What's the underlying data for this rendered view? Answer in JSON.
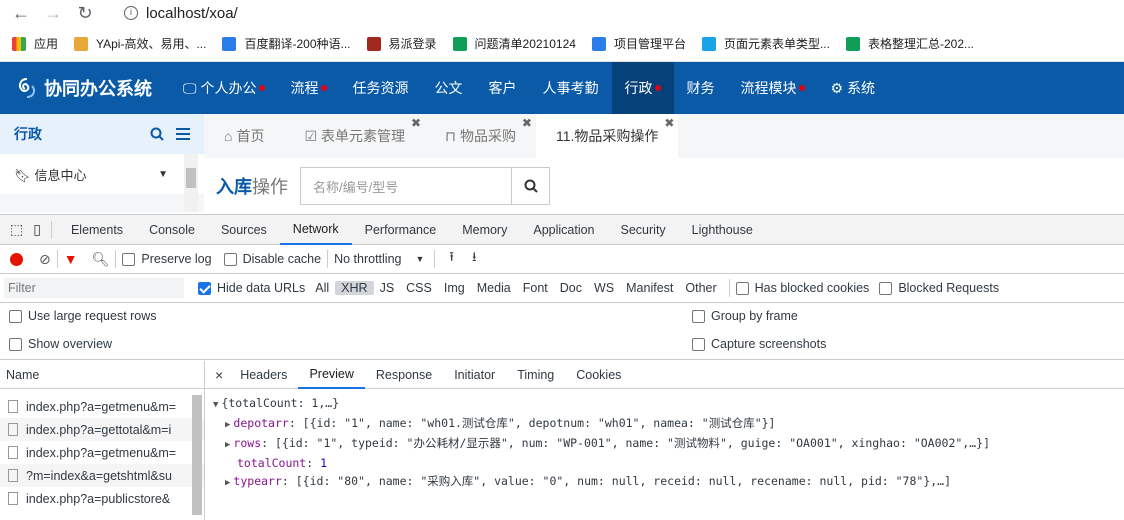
{
  "browser": {
    "url": "localhost/xoa/"
  },
  "bookmarks": [
    {
      "label": "应用",
      "icon": "apps-grid-icon",
      "color": "#4285f4"
    },
    {
      "label": "YApi-高效、易用、...",
      "icon": "yapi-logo-icon",
      "color": "#e8a838"
    },
    {
      "label": "百度翻译-200种语...",
      "icon": "baidu-translate-icon",
      "color": "#2b7de9"
    },
    {
      "label": "易派登录",
      "icon": "ball-icon",
      "color": "#a0281e"
    },
    {
      "label": "问题清单20210124",
      "icon": "sheets-icon",
      "color": "#0f9d58"
    },
    {
      "label": "项目管理平台",
      "icon": "swirl-icon",
      "color": "#2b7de9"
    },
    {
      "label": "页面元素表单类型...",
      "icon": "chat-icon",
      "color": "#1aa3e8"
    },
    {
      "label": "表格整理汇总-202...",
      "icon": "sheets-icon",
      "color": "#0f9d58"
    }
  ],
  "app": {
    "title": "协同办公系统"
  },
  "nav": [
    {
      "label": "个人办公",
      "icon": "monitor-icon",
      "dot": true
    },
    {
      "label": "流程",
      "icon": "",
      "dot": true
    },
    {
      "label": "任务资源",
      "icon": "",
      "dot": false
    },
    {
      "label": "公文",
      "icon": "",
      "dot": false
    },
    {
      "label": "客户",
      "icon": "",
      "dot": false
    },
    {
      "label": "人事考勤",
      "icon": "",
      "dot": false
    },
    {
      "label": "行政",
      "icon": "",
      "dot": true,
      "active": true
    },
    {
      "label": "财务",
      "icon": "",
      "dot": false
    },
    {
      "label": "流程模块",
      "icon": "",
      "dot": true
    },
    {
      "label": "系统",
      "icon": "gear-icon",
      "dot": false
    }
  ],
  "sidebar": {
    "title": "行政",
    "item": "信息中心"
  },
  "tabs": [
    {
      "label": "首页",
      "icon": "home-icon",
      "closable": false
    },
    {
      "label": "表单元素管理",
      "icon": "check-square-icon",
      "closable": true
    },
    {
      "label": "物品采购",
      "icon": "bookmark-icon",
      "closable": true
    },
    {
      "label": "11.物品采购操作",
      "icon": "",
      "closable": true,
      "active": true
    }
  ],
  "content": {
    "title_strong": "入库",
    "title_rest": "操作",
    "search_placeholder": "名称/编号/型号"
  },
  "devtools": {
    "tabs": [
      "Elements",
      "Console",
      "Sources",
      "Network",
      "Performance",
      "Memory",
      "Application",
      "Security",
      "Lighthouse"
    ],
    "active_tab": "Network",
    "toolbar": {
      "preserve_log": "Preserve log",
      "disable_cache": "Disable cache",
      "throttling": "No throttling"
    },
    "filter": {
      "placeholder": "Filter",
      "hide_data_urls": "Hide data URLs",
      "types": [
        "All",
        "XHR",
        "JS",
        "CSS",
        "Img",
        "Media",
        "Font",
        "Doc",
        "WS",
        "Manifest",
        "Other"
      ],
      "active_type": "XHR",
      "has_blocked_cookies": "Has blocked cookies",
      "blocked_requests": "Blocked Requests"
    },
    "options": {
      "large_rows": "Use large request rows",
      "group_by_frame": "Group by frame",
      "show_overview": "Show overview",
      "capture_screenshots": "Capture screenshots"
    },
    "name_header": "Name",
    "requests": [
      "index.php?a=getmenu&m=",
      "index.php?a=gettotal&m=i",
      "index.php?a=getmenu&m=",
      "?m=index&a=getshtml&su",
      "index.php?a=publicstore&"
    ],
    "detail_tabs": [
      "Headers",
      "Preview",
      "Response",
      "Initiator",
      "Timing",
      "Cookies"
    ],
    "active_detail_tab": "Preview",
    "preview": {
      "root": "{totalCount: 1,…}",
      "lines": [
        {
          "key": "depotarr",
          "value": "[{id: \"1\", name: \"wh01.测试仓库\", depotnum: \"wh01\", namea: \"测试仓库\"}]",
          "expandable": true
        },
        {
          "key": "rows",
          "value": "[{id: \"1\", typeid: \"办公耗材/显示器\", num: \"WP-001\", name: \"测试物料\", guige: \"OA001\", xinghao: \"OA002\",…}]",
          "expandable": true
        },
        {
          "key": "totalCount",
          "value": "1",
          "expandable": false
        },
        {
          "key": "typearr",
          "value": "[{id: \"80\", name: \"采购入库\", value: \"0\", num: null, receid: null, recename: null, pid: \"78\"},…]",
          "expandable": true
        }
      ]
    }
  }
}
